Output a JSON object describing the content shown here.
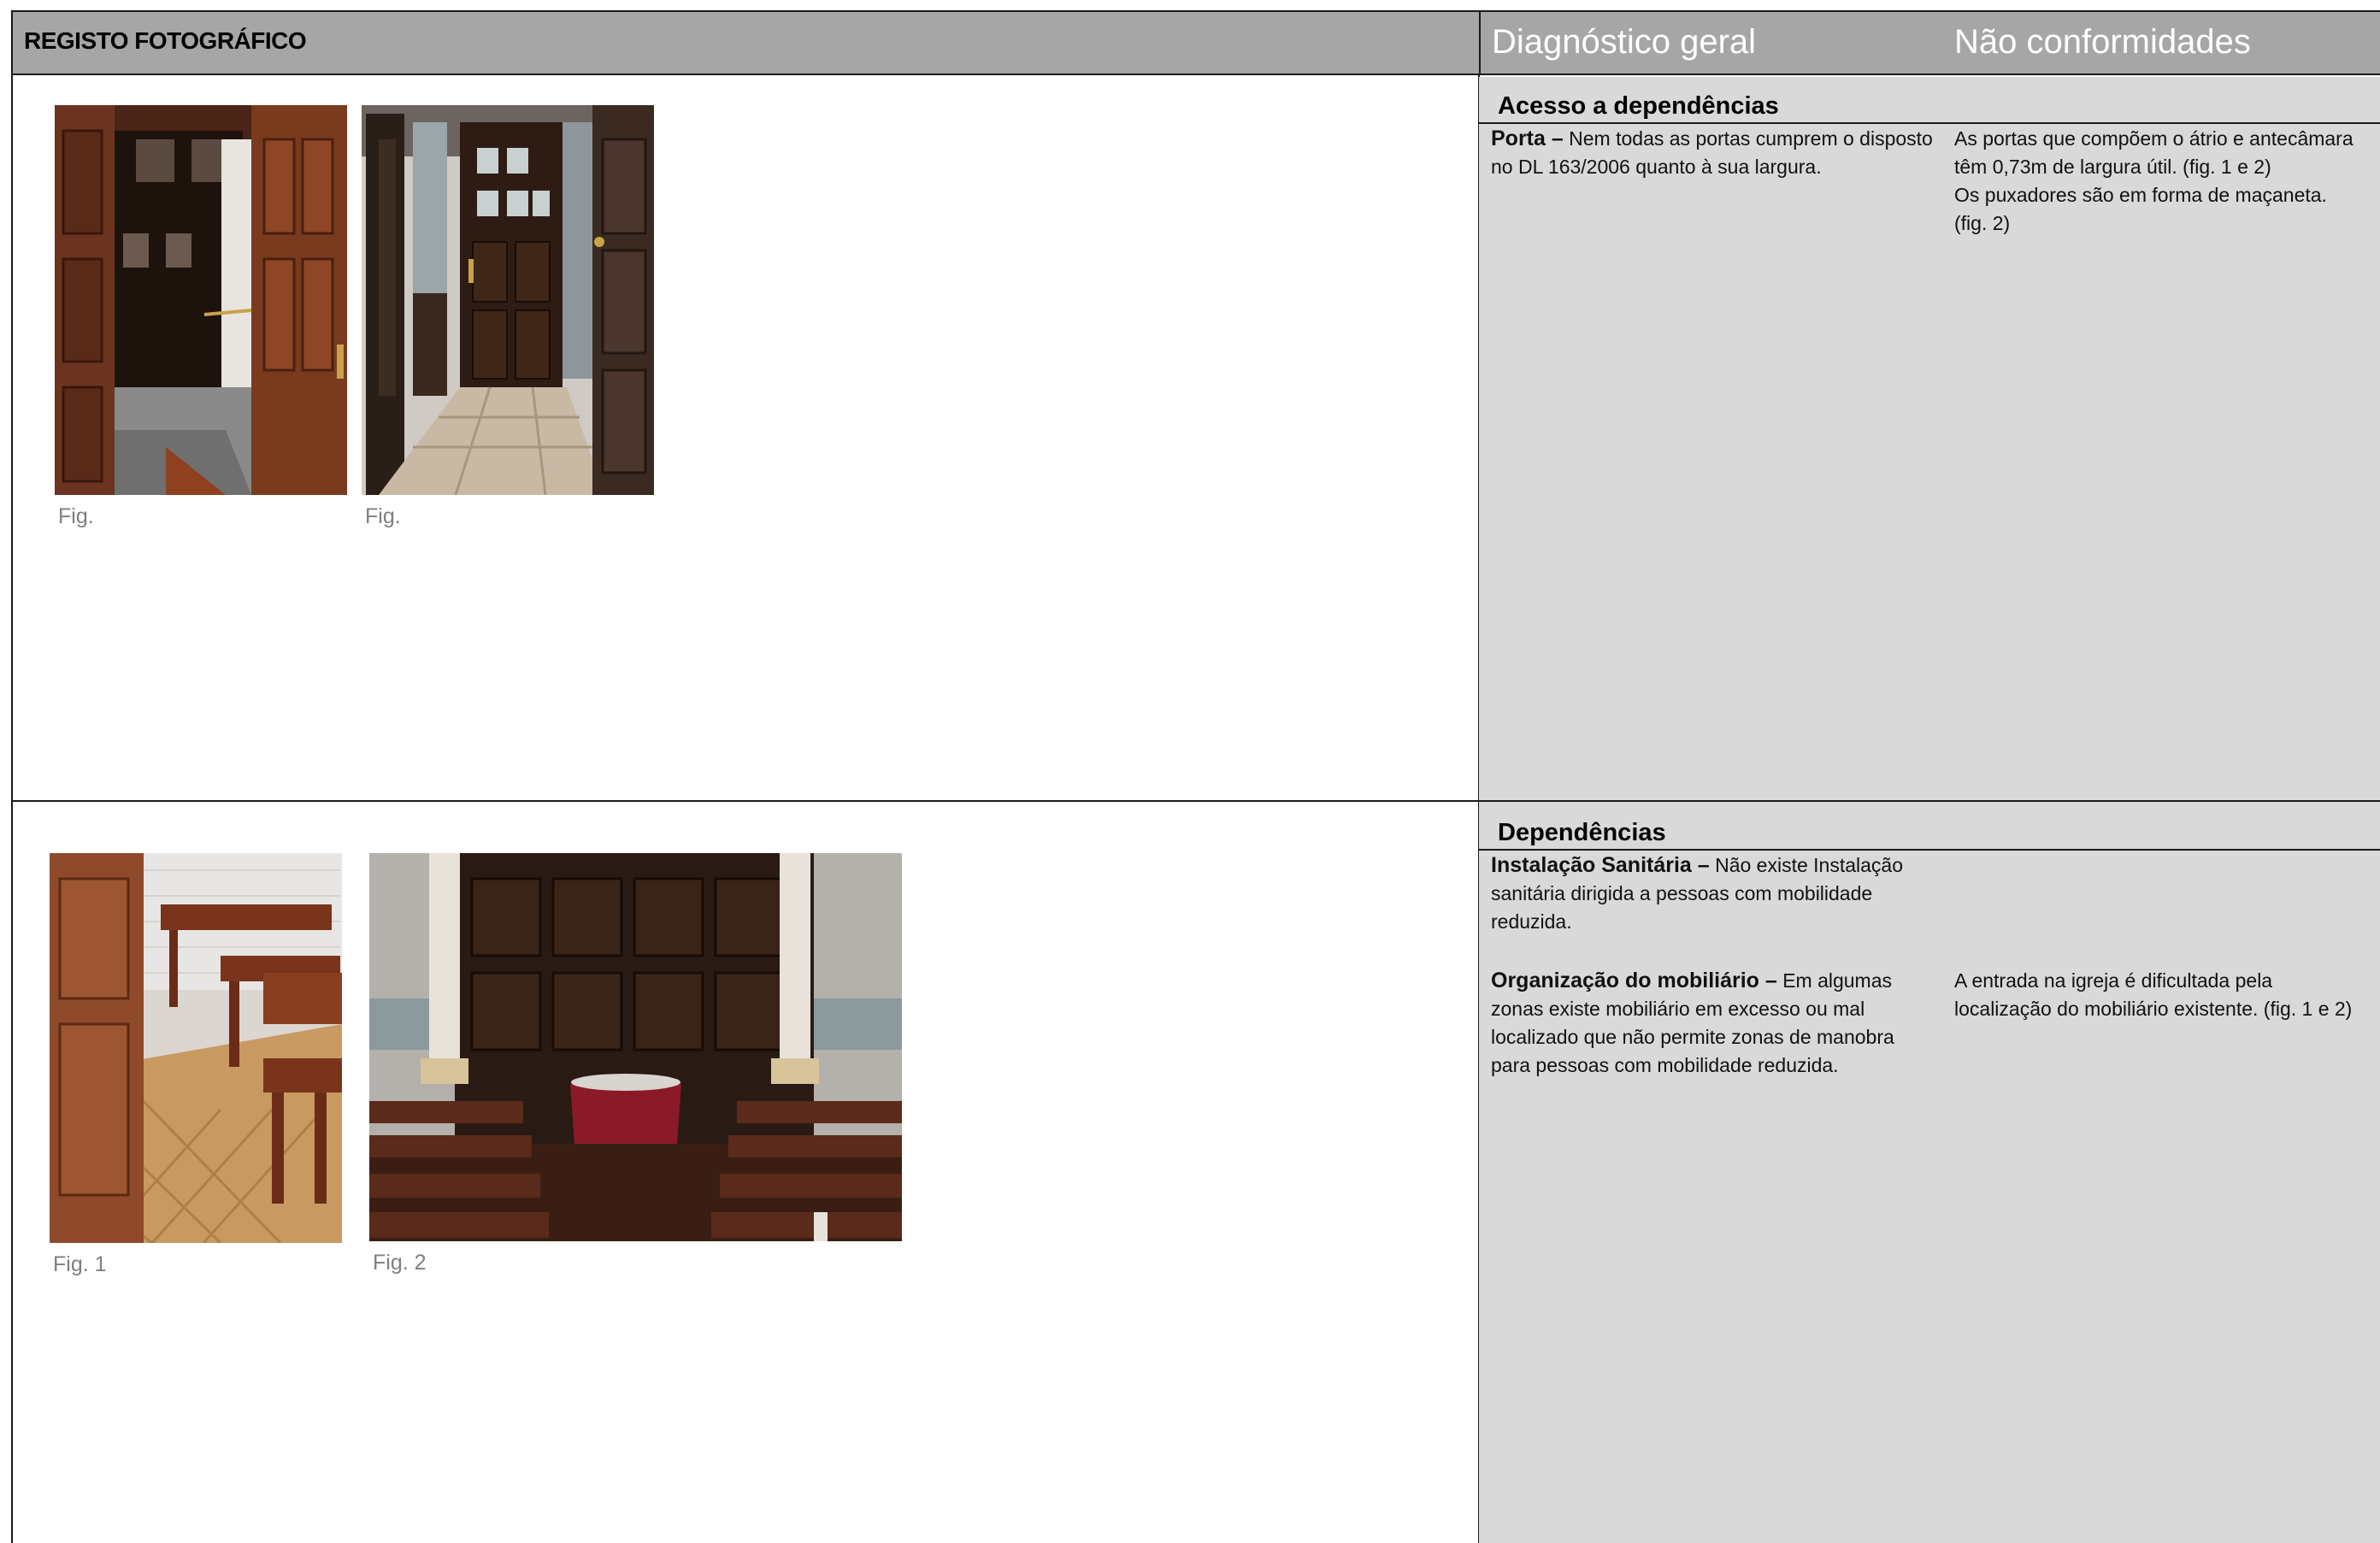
{
  "header": {
    "left_title": "REGISTO FOTOGRÁFICO",
    "col_diagnostico": "Diagnóstico geral",
    "col_nao_conformidades": "Não conformidades"
  },
  "sections": [
    {
      "title": "Acesso a dependências",
      "items": [
        {
          "term": "Porta –",
          "diagnostic": "Nem todas as portas cumprem o disposto no DL 163/2006 quanto à sua largura.",
          "nonconformity_lines": [
            "As portas que compõem o átrio e antecâmara",
            "têm 0,73m de largura útil. (fig. 1 e 2)",
            "Os puxadores são em forma de maçaneta.",
            "(fig. 2)"
          ]
        }
      ],
      "photos": [
        {
          "caption": "Fig.",
          "subject": "wooden door open to vestibule"
        },
        {
          "caption": "Fig.",
          "subject": "wooden doors in tiled corridor"
        }
      ]
    },
    {
      "title": "Dependências",
      "items": [
        {
          "term": "Instalação Sanitária –",
          "diagnostic_lines": [
            "Não existe Instalação",
            "sanitária dirigida a pessoas com mobilidade",
            "reduzida."
          ]
        },
        {
          "term": "Organização do mobiliário –",
          "diagnostic_lines": [
            "Em algumas",
            "zonas existe mobiliário em excesso ou mal",
            "localizado que não permite zonas de manobra",
            "para pessoas com mobilidade reduzida."
          ],
          "nonconformity_lines": [
            "A entrada na igreja é dificultada pela",
            "localização do mobiliário existente. (fig. 1 e 2)"
          ]
        }
      ],
      "photos": [
        {
          "caption": "Fig. 1",
          "subject": "wooden pews on parquet floor"
        },
        {
          "caption": "Fig. 2",
          "subject": "church entrance with pews and columns"
        }
      ]
    }
  ],
  "colors": {
    "header_bg": "#a6a6a6",
    "panel_bg": "#d9d9d9",
    "caption": "#7f7f7f"
  }
}
